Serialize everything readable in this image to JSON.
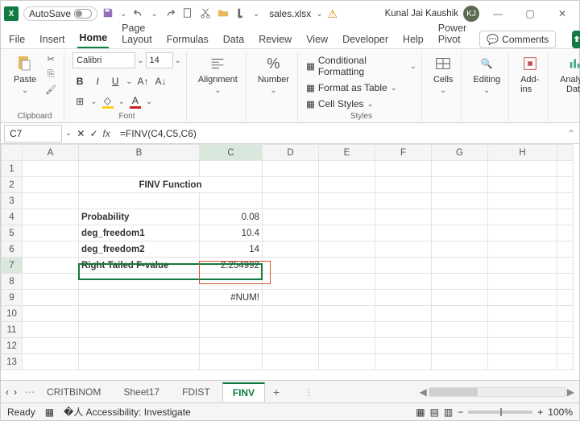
{
  "title": {
    "autosave": "AutoSave",
    "filename": "sales.xlsx",
    "user": "Kunal Jai Kaushik",
    "initials": "KJ"
  },
  "tabs": {
    "file": "File",
    "insert": "Insert",
    "home": "Home",
    "page": "Page Layout",
    "formulas": "Formulas",
    "data": "Data",
    "review": "Review",
    "view": "View",
    "developer": "Developer",
    "help": "Help",
    "power": "Power Pivot",
    "comments": "Comments"
  },
  "ribbon": {
    "paste": "Paste",
    "clipboard": "Clipboard",
    "font": "Font",
    "fontname": "Calibri",
    "fontsize": "14",
    "alignment": "Alignment",
    "number": "Number",
    "styles": "Styles",
    "cells": "Cells",
    "editing": "Editing",
    "addins": "Add-ins",
    "analyze": "Analyze Data",
    "cf": "Conditional Formatting",
    "ft": "Format as Table",
    "cs": "Cell Styles"
  },
  "namebox": "C7",
  "formula": "=FINV(C4,C5,C6)",
  "cols": [
    "A",
    "B",
    "C",
    "D",
    "E",
    "F",
    "G",
    "H"
  ],
  "rows": [
    "1",
    "2",
    "3",
    "4",
    "5",
    "6",
    "7",
    "8",
    "9",
    "10",
    "11",
    "12",
    "13"
  ],
  "cells": {
    "title": "FINV Function",
    "b4": "Probability",
    "c4": "0.08",
    "b5": "deg_freedom1",
    "c5": "10.4",
    "b6": "deg_freedom2",
    "c6": "14",
    "b7": "Right Tailed F-value",
    "c7": "2.254992",
    "c9": "#NUM!"
  },
  "sheettabs": {
    "t1": "CRITBINOM",
    "t2": "Sheet17",
    "t3": "FDIST",
    "t4": "FINV"
  },
  "status": {
    "ready": "Ready",
    "acc": "Accessibility: Investigate",
    "zoom": "100%"
  },
  "chev": "⌄",
  "plus": "+",
  "minus": "−",
  "dots": "⋯"
}
